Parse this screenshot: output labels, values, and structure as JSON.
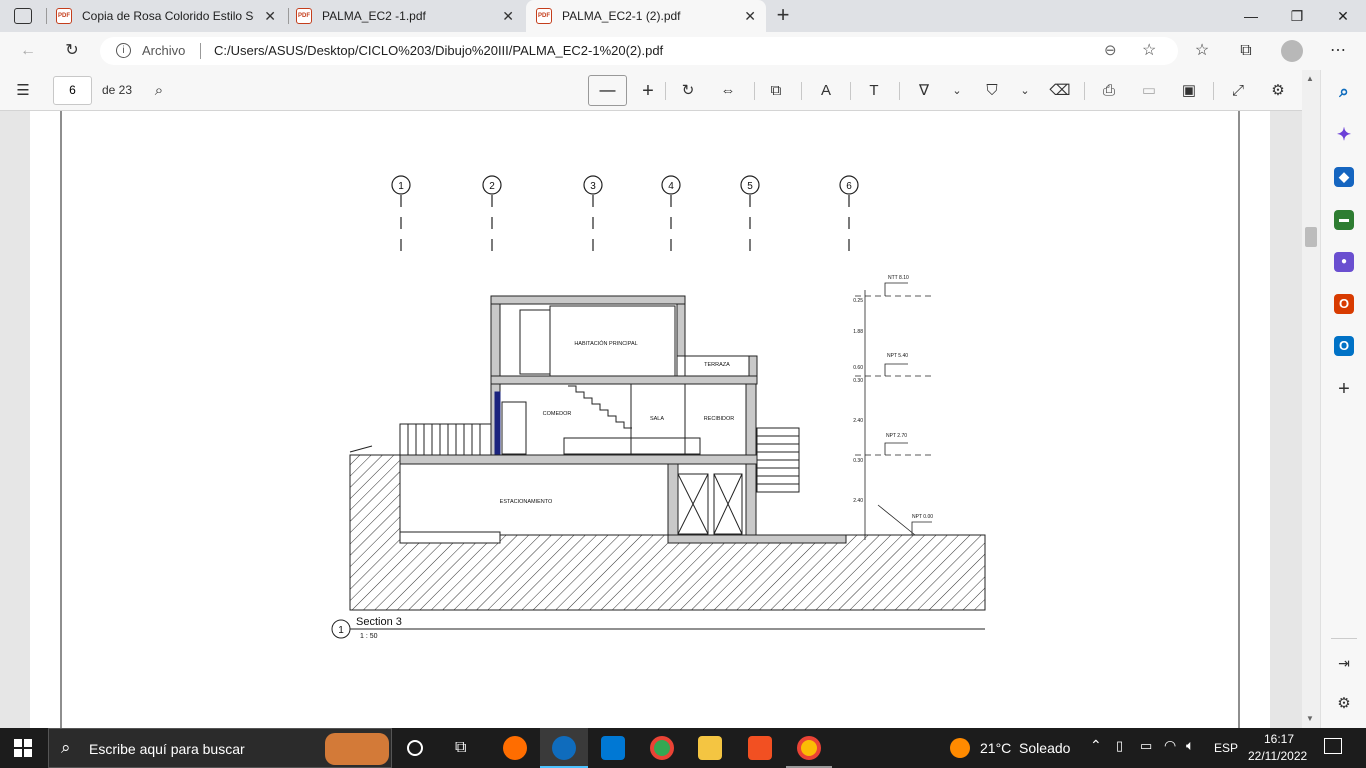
{
  "tabs": [
    {
      "label": "Copia de Rosa Colorido Estilo Se",
      "icon": "pdf-icon"
    },
    {
      "label": "PALMA_EC2 -1.pdf",
      "icon": "pdf-icon"
    },
    {
      "label": "PALMA_EC2-1 (2).pdf",
      "icon": "pdf-icon",
      "active": true
    }
  ],
  "address": {
    "scheme_label": "Archivo",
    "url": "C:/Users/ASUS/Desktop/CICLO%203/Dibujo%20III/PALMA_EC2-1%20(2).pdf"
  },
  "pdf_toolbar": {
    "page_number": "6",
    "page_total": "de 23"
  },
  "drawing": {
    "grid_labels": [
      "1",
      "2",
      "3",
      "4",
      "5",
      "6"
    ],
    "rooms": {
      "habitacion": "HABITACIÓN PRINCIPAL",
      "terraza": "TERRAZA",
      "comedor": "COMEDOR",
      "sala": "SALA",
      "recibidor": "RECIBIDOR",
      "estacionamiento": "ESTACIONAMIENTO"
    },
    "levels": {
      "ntt": "NTT 8.10",
      "npt2": "NPT 5.40",
      "npt1": "NPT 2.70",
      "npt0": "NPT 0.00"
    },
    "dims": [
      "0.25",
      "1.88",
      "0.60",
      "0.30",
      "2.40",
      "0.30",
      "2.40"
    ],
    "section_marker": "1",
    "section_title": "Section 3",
    "section_scale": "1 : 50"
  },
  "taskbar": {
    "search_placeholder": "Escribe aquí para buscar",
    "weather": "21°C  Soleado",
    "lang": "ESP",
    "time": "16:17",
    "date": "22/11/2022"
  },
  "colors": {
    "tab_bar": "#dfe1e5",
    "toolbar": "#f7f7f7",
    "taskbar": "#1c1c1c",
    "pdf_red": "#c43e1c",
    "edge_blue": "#0f6cbd"
  }
}
